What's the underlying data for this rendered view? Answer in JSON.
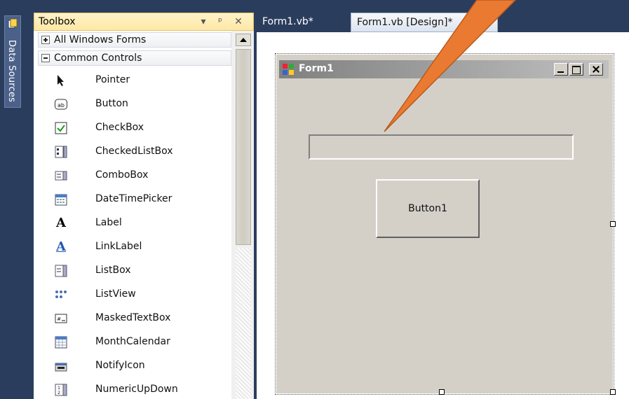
{
  "side_panel": {
    "data_sources_label": "Data Sources"
  },
  "toolbox": {
    "title": "Toolbox",
    "categories": [
      {
        "label": "All Windows Forms",
        "expanded": false
      },
      {
        "label": "Common Controls",
        "expanded": true
      }
    ],
    "items": [
      {
        "label": "Pointer",
        "icon": "pointer-icon"
      },
      {
        "label": "Button",
        "icon": "button-icon"
      },
      {
        "label": "CheckBox",
        "icon": "checkbox-icon"
      },
      {
        "label": "CheckedListBox",
        "icon": "checkedlistbox-icon"
      },
      {
        "label": "ComboBox",
        "icon": "combobox-icon"
      },
      {
        "label": "DateTimePicker",
        "icon": "datetimepicker-icon"
      },
      {
        "label": "Label",
        "icon": "label-icon"
      },
      {
        "label": "LinkLabel",
        "icon": "linklabel-icon"
      },
      {
        "label": "ListBox",
        "icon": "listbox-icon"
      },
      {
        "label": "ListView",
        "icon": "listview-icon"
      },
      {
        "label": "MaskedTextBox",
        "icon": "maskedtextbox-icon"
      },
      {
        "label": "MonthCalendar",
        "icon": "monthcalendar-icon"
      },
      {
        "label": "NotifyIcon",
        "icon": "notifyicon-icon"
      },
      {
        "label": "NumericUpDown",
        "icon": "numericupdown-icon"
      }
    ]
  },
  "tabs": [
    {
      "label": "Form1.vb*",
      "active": false
    },
    {
      "label": "Form1.vb [Design]*",
      "active": true
    }
  ],
  "form": {
    "title": "Form1",
    "button_label": "Button1",
    "textbox_value": ""
  },
  "colors": {
    "ide_background": "#2b3d5d",
    "toolbox_header": "#ffe8a6",
    "form_face": "#d4d0c8",
    "callout_arrow": "#ea7a31"
  }
}
